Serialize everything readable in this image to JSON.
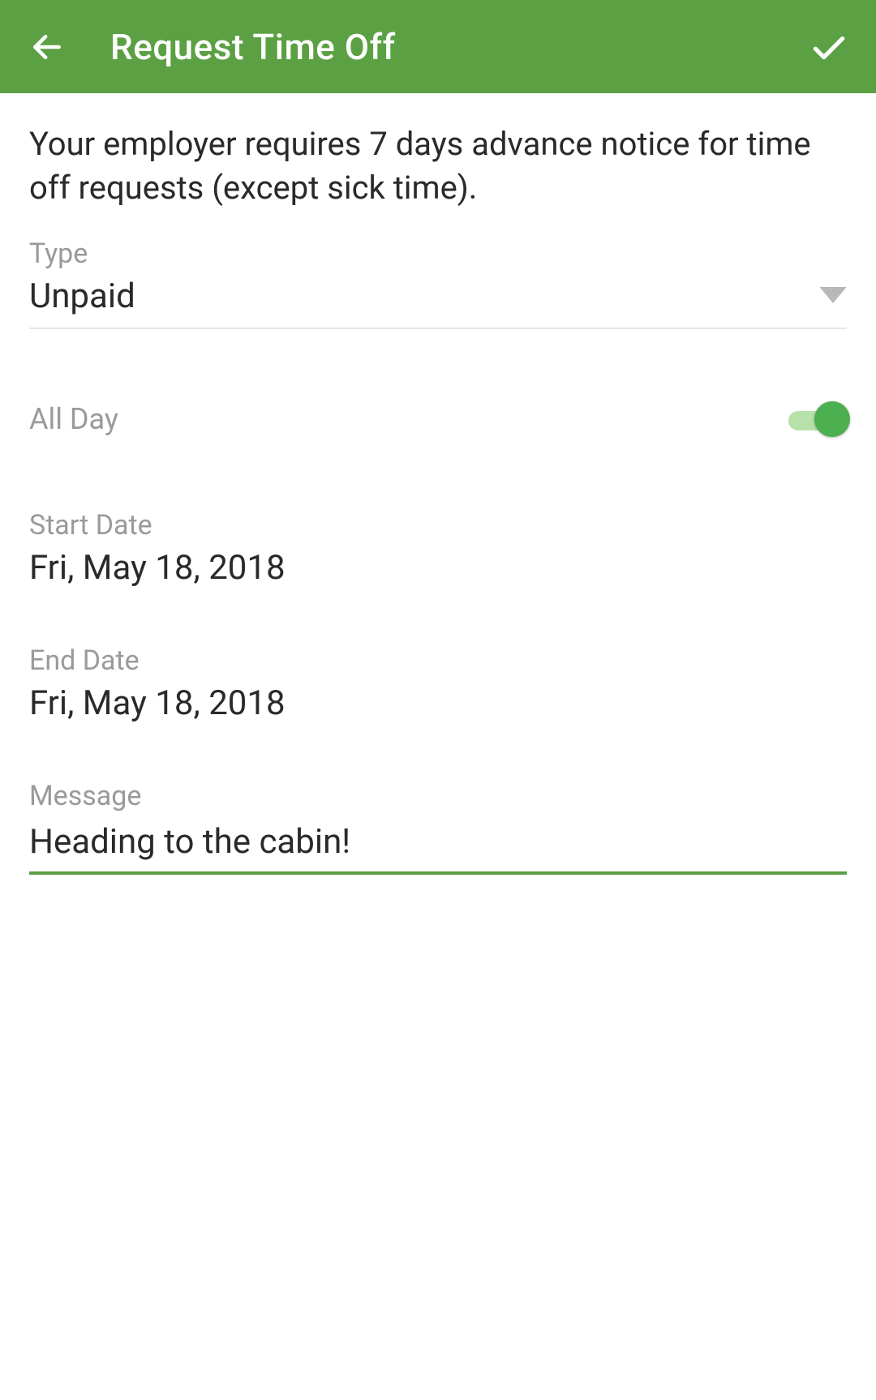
{
  "header": {
    "title": "Request Time Off"
  },
  "notice": "Your employer requires 7 days advance notice for time off requests (except sick time).",
  "type_field": {
    "label": "Type",
    "value": "Unpaid"
  },
  "all_day": {
    "label": "All Day",
    "on": true
  },
  "start_date": {
    "label": "Start Date",
    "value": "Fri, May 18, 2018"
  },
  "end_date": {
    "label": "End Date",
    "value": "Fri, May 18, 2018"
  },
  "message": {
    "label": "Message",
    "value": "Heading to the cabin!"
  }
}
